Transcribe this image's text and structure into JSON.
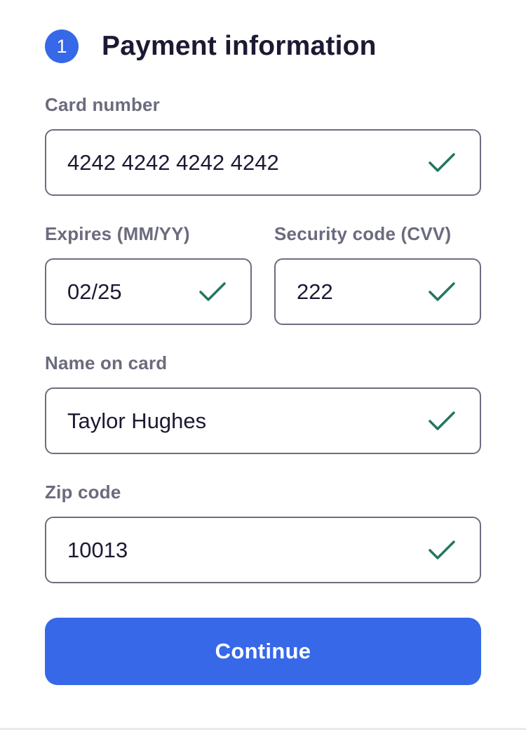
{
  "header": {
    "step_number": "1",
    "title": "Payment information"
  },
  "fields": {
    "card_number": {
      "label": "Card number",
      "value": "4242 4242 4242 4242",
      "valid": true
    },
    "expires": {
      "label": "Expires (MM/YY)",
      "value": "02/25",
      "valid": true
    },
    "cvv": {
      "label": "Security code (CVV)",
      "value": "222",
      "valid": true
    },
    "name": {
      "label": "Name on card",
      "value": "Taylor Hughes",
      "valid": true
    },
    "zip": {
      "label": "Zip code",
      "value": "10013",
      "valid": true
    }
  },
  "actions": {
    "continue_label": "Continue"
  },
  "colors": {
    "accent": "#3668e8",
    "title_text": "#1b1a33",
    "label_text": "#6b6b7e",
    "field_border": "#6d6d80",
    "valid_check": "#257563"
  },
  "icons": {
    "valid_indicator": "checkmark-icon"
  }
}
